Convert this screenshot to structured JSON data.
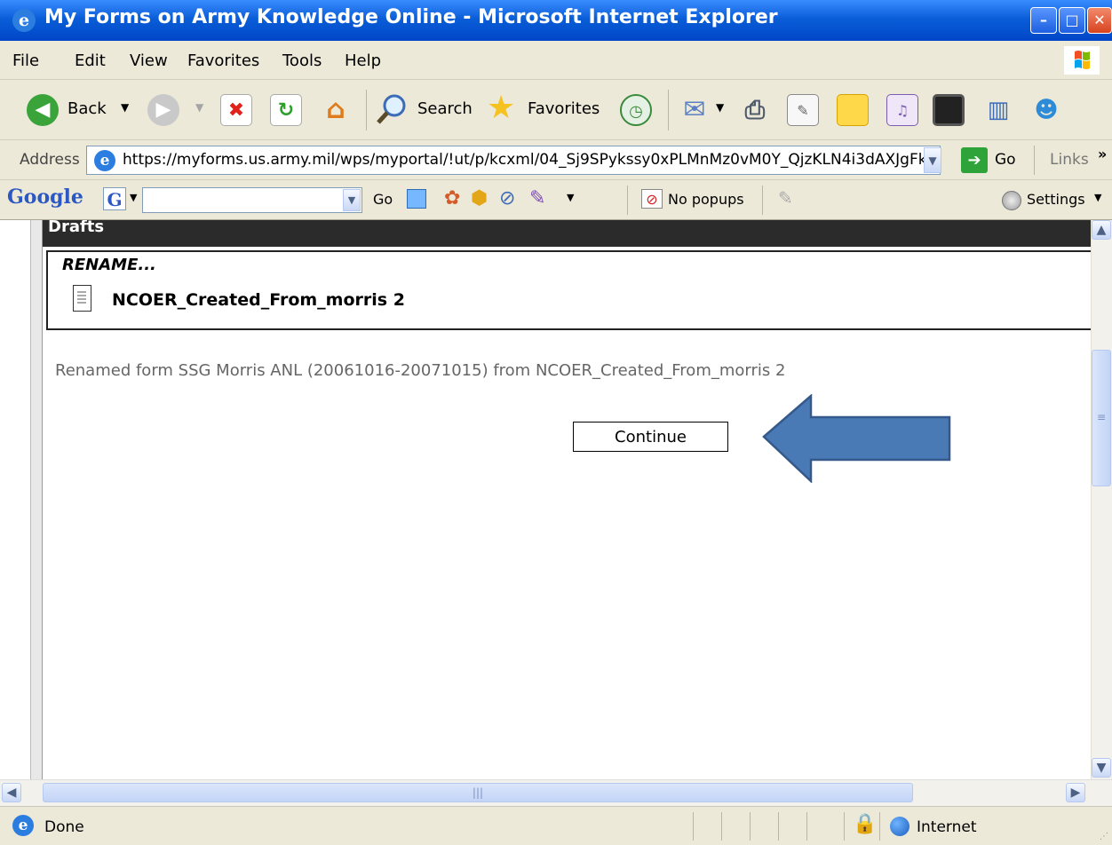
{
  "window": {
    "title": "My Forms on Army Knowledge Online - Microsoft Internet Explorer",
    "minimize_glyph": "–",
    "maximize_glyph": "□",
    "close_glyph": "✕"
  },
  "menu": [
    "File",
    "Edit",
    "View",
    "Favorites",
    "Tools",
    "Help"
  ],
  "toolbar": {
    "back_label": "Back",
    "search_label": "Search",
    "favorites_label": "Favorites"
  },
  "address": {
    "label": "Address",
    "url": "https://myforms.us.army.mil/wps/myportal/!ut/p/kcxml/04_Sj9SPykssy0xPLMnMz0vM0Y_QjzKLN4i3dAXJgFk",
    "go_label": "Go",
    "links_label": "Links",
    "links_more": "»"
  },
  "google_toolbar": {
    "logo": "Google",
    "go_label": "Go",
    "popups_label": "No popups",
    "settings_label": "Settings"
  },
  "page": {
    "section_title": "Drafts",
    "rename_heading": "RENAME...",
    "document_name": "NCOER_Created_From_morris 2",
    "message": "Renamed form SSG Morris ANL (20061016-20071015) from NCOER_Created_From_morris 2",
    "continue_label": "Continue"
  },
  "annotation": {
    "arrow_color": "#4a7ab5",
    "arrow_outline": "#34598a"
  },
  "status": {
    "text": "Done",
    "zone": "Internet"
  }
}
